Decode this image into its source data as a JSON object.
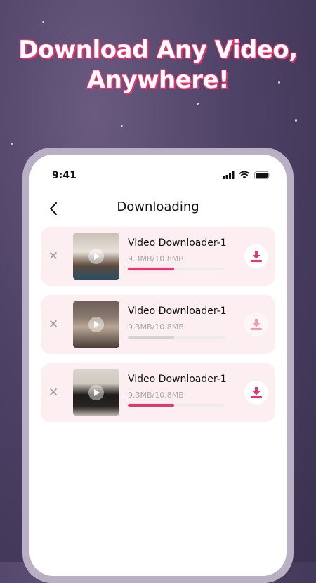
{
  "promo": {
    "headline_line1": "Download Any Video,",
    "headline_line2": "Anywhere!"
  },
  "status_bar": {
    "time": "9:41"
  },
  "header": {
    "title": "Downloading"
  },
  "downloads": [
    {
      "name": "Video Downloader-1",
      "size": "9.3MB/10.8MB",
      "progress": 0.48,
      "active": true
    },
    {
      "name": "Video Downloader-1",
      "size": "9.3MB/10.8MB",
      "progress": 0.48,
      "active": false
    },
    {
      "name": "Video Downloader-1",
      "size": "9.3MB/10.8MB",
      "progress": 0.48,
      "active": true
    }
  ],
  "colors": {
    "accent": "#e8336b",
    "card_bg": "#fdeff1",
    "frame": "#b9b0c4"
  }
}
